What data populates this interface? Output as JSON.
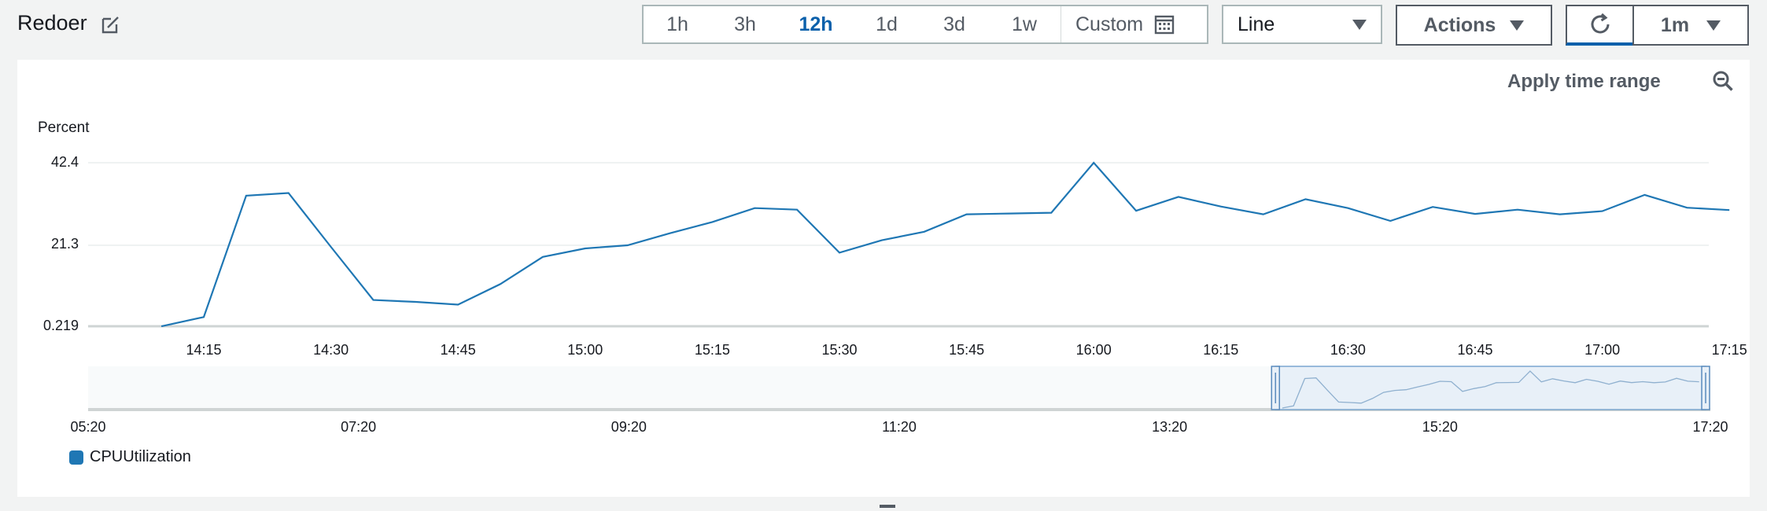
{
  "header": {
    "title": "Redoer",
    "time_ranges": [
      "1h",
      "3h",
      "12h",
      "1d",
      "3d",
      "1w"
    ],
    "active_range": "12h",
    "custom_label": "Custom",
    "chart_type_select": "Line",
    "actions_label": "Actions",
    "refresh_interval": "1m"
  },
  "panel": {
    "apply_time_range_label": "Apply time range",
    "legend_label": "CPUUtilization"
  },
  "colors": {
    "accent": "#0a60ab",
    "series": "#1f77b4",
    "panel_bg": "#ffffff",
    "page_bg": "#f2f3f3"
  },
  "icons": {
    "edit": "edit-icon",
    "calendar": "calendar-icon",
    "refresh": "refresh-icon",
    "zoom_out": "zoom-out-icon"
  },
  "chart_data": {
    "type": "line",
    "ylabel": "Percent",
    "yticks": [
      "42.4",
      "21.3",
      "0.219"
    ],
    "ylim": [
      0.219,
      42.4
    ],
    "xticks": [
      "14:15",
      "14:30",
      "14:45",
      "15:00",
      "15:15",
      "15:30",
      "15:45",
      "16:00",
      "16:15",
      "16:30",
      "16:45",
      "17:00",
      "17:15"
    ],
    "x": [
      "14:10",
      "14:15",
      "14:20",
      "14:25",
      "14:30",
      "14:35",
      "14:40",
      "14:45",
      "14:50",
      "14:55",
      "15:00",
      "15:05",
      "15:10",
      "15:15",
      "15:20",
      "15:25",
      "15:30",
      "15:35",
      "15:40",
      "15:45",
      "15:50",
      "15:55",
      "16:00",
      "16:05",
      "16:10",
      "16:15",
      "16:20",
      "16:25",
      "16:30",
      "16:35",
      "16:40",
      "16:45",
      "16:50",
      "16:55",
      "17:00",
      "17:05",
      "17:10",
      "17:15"
    ],
    "series": [
      {
        "name": "CPUUtilization",
        "values": [
          0.2,
          2.6,
          33.9,
          34.6,
          20.7,
          7.0,
          6.5,
          5.8,
          11.1,
          18.1,
          20.3,
          21.1,
          24.2,
          27.1,
          30.7,
          30.3,
          19.2,
          22.4,
          24.6,
          29.1,
          29.3,
          29.5,
          42.4,
          30.0,
          33.6,
          31.1,
          29.1,
          33.0,
          30.7,
          27.4,
          31.0,
          29.2,
          30.3,
          29.1,
          29.9,
          34.1,
          30.8,
          30.2
        ]
      }
    ],
    "navigator": {
      "xticks": [
        "05:20",
        "07:20",
        "09:20",
        "11:20",
        "13:20",
        "15:20",
        "17:20"
      ],
      "selected_range": [
        "14:07",
        "17:20"
      ]
    },
    "grid": true,
    "legend_position": "bottom-left"
  }
}
